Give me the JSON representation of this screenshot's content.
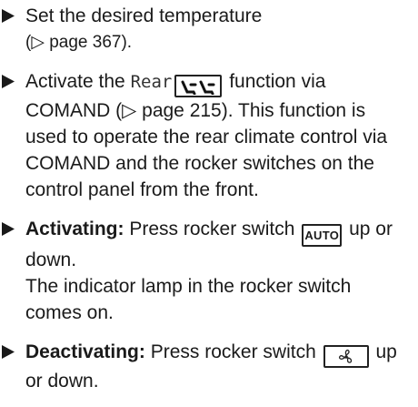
{
  "steps": [
    {
      "line1": "Set the desired temperature",
      "line2": "(▷ page 367)."
    },
    {
      "line1_pre": "Activate the",
      "rear_label": "Rear",
      "line1_post": "function via",
      "line2": "COMAND (▷ page 215). This function is",
      "line3": "used to operate the rear climate control via",
      "line4": "COMAND and the rocker switches on the",
      "line5": "control panel from the front."
    },
    {
      "bold": "Activating:",
      "line1_pre": "Press rocker switch",
      "key_label": "AUTO",
      "line1_post": "up or",
      "line2": "down.",
      "result1": "The indicator lamp in the rocker switch",
      "result2": "comes on."
    },
    {
      "bold": "Deactivating:",
      "line1_pre": "Press rocker switch",
      "line1_post": "up",
      "line2": "or down."
    }
  ],
  "icons": {
    "bullet": "triangle-bullet-icon",
    "rear_climate": "rear-seats-icon",
    "fan": "fan-icon"
  }
}
